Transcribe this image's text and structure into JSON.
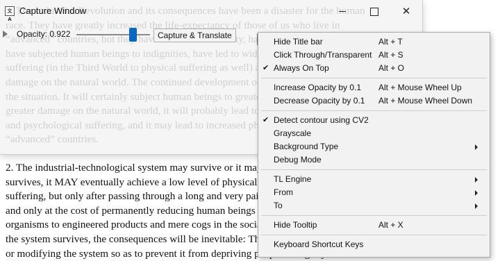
{
  "document": {
    "lines_top": [
      "1. The Industrial Revolution and its consequences have been a disaster for the human",
      "race. They have greatly increased the life-expectancy of those of us who live in",
      "“advanced” countries, but they have destabilized society, have made life unfulfilling,",
      "have subjected human beings to indignities, have led to widespread psychological",
      "suffering (in the Third World to physical suffering as well) and have inflicted severe",
      "damage on the natural world. The continued development of technology will worsen",
      "the situation. It will certainly subject human beings to greater indignities and inflict",
      "greater damage on the natural world, it will probably lead to greater social disruption",
      "and psychological suffering, and it may lead to increased physical suffering even in",
      "“advanced” countries."
    ],
    "lines_bottom": [
      "2. The industrial-technological system may survive or it may break down. If it",
      "survives, it MAY eventually achieve a low level of physical and psychological",
      "suffering, but only after passing through a long and very painful period of adjustment",
      "and only at the cost of permanently reducing human beings and many other living",
      "organisms to engineered products and mere cogs in the social machine. Furthermore, if",
      "the system survives, the consequences will be inevitable: There is no way of reforming",
      "or modifying the system so as to prevent it from depriving people of dignity and"
    ]
  },
  "window": {
    "title": "Capture Window",
    "icon_text": "文A",
    "opacity_label": "Opacity: 0.922",
    "opacity_value": 0.922,
    "capture_button": "Capture & Translate"
  },
  "menu": {
    "groups": [
      [
        {
          "label": "Hide Title bar",
          "shortcut": "Alt + T",
          "checked": false,
          "submenu": false
        },
        {
          "label": "Click Through/Transparent",
          "shortcut": "Alt + S",
          "checked": false,
          "submenu": false
        },
        {
          "label": "Always On Top",
          "shortcut": "Alt + O",
          "checked": true,
          "submenu": false
        }
      ],
      [
        {
          "label": "Increase Opacity by 0.1",
          "shortcut": "Alt + Mouse Wheel Up",
          "checked": false,
          "submenu": false
        },
        {
          "label": "Decrease Opacity by 0.1",
          "shortcut": "Alt + Mouse Wheel Down",
          "checked": false,
          "submenu": false
        }
      ],
      [
        {
          "label": "Detect contour using CV2",
          "shortcut": "",
          "checked": true,
          "submenu": false
        },
        {
          "label": "Grayscale",
          "shortcut": "",
          "checked": false,
          "submenu": false
        },
        {
          "label": "Background Type",
          "shortcut": "",
          "checked": false,
          "submenu": true
        },
        {
          "label": "Debug Mode",
          "shortcut": "",
          "checked": false,
          "submenu": false
        }
      ],
      [
        {
          "label": "TL Engine",
          "shortcut": "",
          "checked": false,
          "submenu": true
        },
        {
          "label": "From",
          "shortcut": "",
          "checked": false,
          "submenu": true
        },
        {
          "label": "To",
          "shortcut": "",
          "checked": false,
          "submenu": true
        }
      ],
      [
        {
          "label": "Hide Tooltip",
          "shortcut": "Alt + X",
          "checked": false,
          "submenu": false
        }
      ],
      [
        {
          "label": "Keyboard Shortcut Keys",
          "shortcut": "",
          "checked": false,
          "submenu": false
        }
      ]
    ]
  },
  "icons": {
    "check": "✔",
    "minimize": "minimize-icon",
    "maximize": "maximize-icon",
    "close": "✕"
  },
  "colors": {
    "slider_thumb": "#0b67c2",
    "menu_background": "#f2f2f2",
    "window_background": "#f3f3f3"
  }
}
